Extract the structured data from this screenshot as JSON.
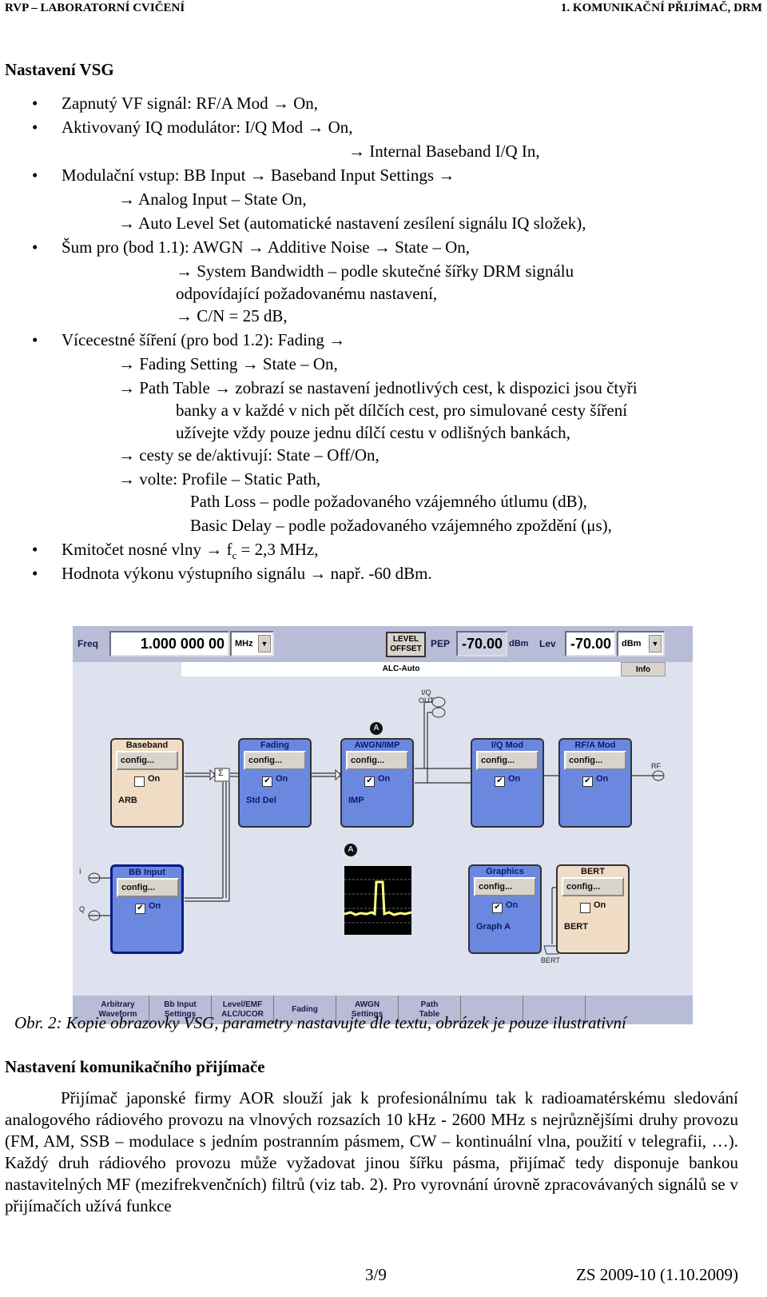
{
  "header": {
    "left": "RVP – LABORATORNÍ CVIČENÍ",
    "right": "1. KOMUNIKAČNÍ PŘIJÍMAČ, DRM"
  },
  "section1": {
    "title": "Nastavení VSG",
    "lines": [
      {
        "bullet": true,
        "text": "Zapnutý VF signál: RF/A Mod → On,"
      },
      {
        "bullet": true,
        "text": "Aktivovaný IQ modulátor: I/Q Mod → On,"
      },
      {
        "bullet": false,
        "text": "→ Internal Baseband I/Q In,"
      },
      {
        "bullet": true,
        "text": "Modulační vstup: BB Input → Baseband Input Settings →"
      },
      {
        "bullet": false,
        "text": "→ Analog Input – State On,"
      },
      {
        "bullet": false,
        "text": "→ Auto Level Set (automatické nastavení zesílení signálu IQ složek),"
      },
      {
        "bullet": true,
        "text": "Šum pro (bod 1.1): AWGN   → Additive Noise  → State – On,"
      },
      {
        "bullet": false,
        "text": "→ System Bandwidth – podle skutečné šířky DRM signálu"
      },
      {
        "bullet": false,
        "text": "odpovídající požadovanému nastavení,"
      },
      {
        "bullet": false,
        "text": "→ C/N = 25 dB,"
      },
      {
        "bullet": true,
        "text": "Vícecestné šíření (pro bod 1.2): Fading →"
      },
      {
        "bullet": false,
        "text": "→ Fading Setting → State – On,"
      },
      {
        "bullet": false,
        "text": "→ Path Table → zobrazí se nastavení jednotlivých cest, k dispozici jsou čtyři"
      },
      {
        "bullet": false,
        "text": "banky a v každé v nich pět dílčích cest, pro simulované cesty šíření"
      },
      {
        "bullet": false,
        "text": "užívejte vždy pouze jednu dílčí cestu v odlišných bankách,"
      },
      {
        "bullet": false,
        "text": "→ cesty se de/aktivují: State – Off/On,"
      },
      {
        "bullet": false,
        "text": "→ volte: Profile – Static Path,"
      },
      {
        "bullet": false,
        "text": "Path Loss – podle požadovaného vzájemného útlumu (dB),"
      },
      {
        "bullet": false,
        "text": "Basic Delay – podle požadovaného vzájemného zpoždění (μs),"
      },
      {
        "bullet": true,
        "text_pre": "Kmitočet nosné vlny → f",
        "text_sub": "c",
        "text_post": " = 2,3 MHz,"
      },
      {
        "bullet": true,
        "text": "Hodnota výkonu výstupního signálu → např. -60 dBm."
      }
    ]
  },
  "vsg": {
    "freq_label": "Freq",
    "freq_value": "1.000 000 00",
    "freq_unit": "MHz",
    "level_offset": "LEVEL\nOFFSET",
    "pep_label": "PEP",
    "pep_value": "-70.00",
    "pep_unit": "dBm",
    "lev_label": "Lev",
    "lev_value": "-70.00",
    "lev_unit": "dBm",
    "alc_status": "ALC-Auto",
    "info_label": "Info",
    "iq_out_label": "I/Q\nOUT",
    "rf_label": "RF",
    "i_label": "I",
    "q_label": "Q",
    "bert_conn_label": "BERT",
    "badge_a": "A",
    "sum_symbol": "Σ",
    "blocks": [
      {
        "title": "Baseband",
        "config": "config...",
        "on_label": "On",
        "checked": false,
        "sub": "ARB"
      },
      {
        "title": "Fading",
        "config": "config...",
        "on_label": "On",
        "checked": true,
        "sub": "Std Del"
      },
      {
        "title": "AWGN/IMP",
        "config": "config...",
        "on_label": "On",
        "checked": true,
        "sub": "IMP"
      },
      {
        "title": "I/Q Mod",
        "config": "config...",
        "on_label": "On",
        "checked": true,
        "sub": ""
      },
      {
        "title": "RF/A Mod",
        "config": "config...",
        "on_label": "On",
        "checked": true,
        "sub": ""
      },
      {
        "title": "BB Input",
        "config": "config...",
        "on_label": "On",
        "checked": true,
        "sub": ""
      },
      {
        "title": "Graphics",
        "config": "config...",
        "on_label": "On",
        "checked": true,
        "sub": "Graph A"
      },
      {
        "title": "BERT",
        "config": "config...",
        "on_label": "On",
        "checked": false,
        "sub": "BERT"
      }
    ],
    "softkeys": [
      "Arbitrary\nWaveform",
      "Bb Input\nSettings",
      "Level/EMF\nALC/UCOR",
      "Fading",
      "AWGN\nSettings",
      "Path\nTable",
      "",
      ""
    ]
  },
  "caption": "Obr. 2: Kopie obrazovky VSG, parametry nastavujte dle textu, obrázek je pouze ilustrativní",
  "section2": {
    "title": "Nastavení komunikačního přijímače",
    "paragraph": "Přijímač japonské firmy AOR slouží jak k profesionálnímu tak k radioamatérskému sledování analogového rádiového provozu na vlnových rozsazích 10 kHz - 2600 MHz s nejrůznějšími druhy provozu (FM, AM, SSB – modulace s jedním postranním pásmem, CW – kontinuální vlna, použití v telegrafii, …). Každý druh rádiového provozu může vyžadovat jinou šířku pásma, přijímač tedy disponuje bankou nastavitelných MF (mezifrekvenčních) filtrů (viz tab. 2). Pro vyrovnání úrovně zpracovávaných signálů se v přijímačích užívá funkce"
  },
  "footer": {
    "page": "3/9",
    "date": "ZS 2009-10 (1.10.2009)"
  }
}
